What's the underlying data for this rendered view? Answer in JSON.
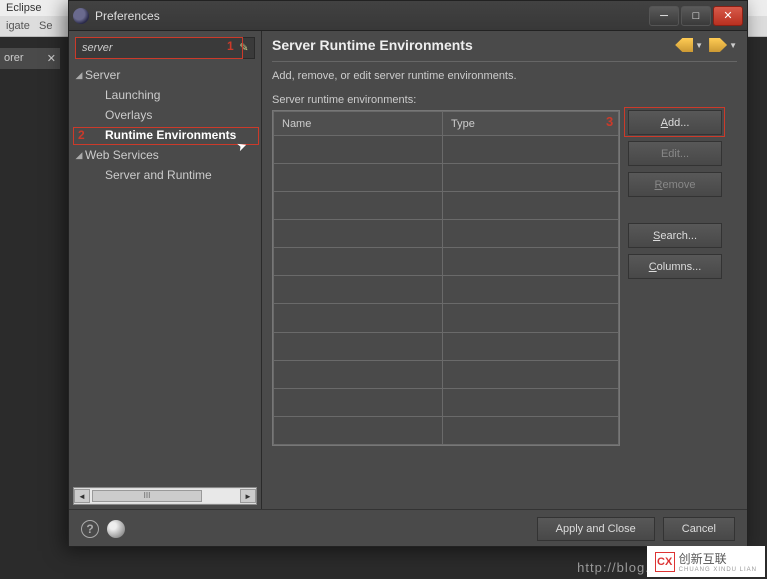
{
  "bg": {
    "title": "Eclipse",
    "menu1": "igate",
    "menu2": "Se",
    "sidebar": "orer"
  },
  "titlebar": {
    "title": "Preferences"
  },
  "search": {
    "value": "server"
  },
  "annotations": {
    "n1": "1",
    "n2": "2",
    "n3": "3"
  },
  "tree": {
    "server": "Server",
    "launching": "Launching",
    "overlays": "Overlays",
    "runtime": "Runtime Environments",
    "webservices": "Web Services",
    "serverruntime": "Server and Runtime"
  },
  "scroll": {
    "thumb_label": "III"
  },
  "right": {
    "title": "Server Runtime Environments",
    "desc": "Add, remove, or edit server runtime environments.",
    "label": "Server runtime environments:",
    "col_name": "Name",
    "col_type": "Type"
  },
  "buttons": {
    "add_u": "A",
    "add_rest": "dd...",
    "edit": "Edit...",
    "remove_u": "R",
    "remove_rest": "emove",
    "search_u": "S",
    "search_rest": "earch...",
    "columns_u": "C",
    "columns_rest": "olumns..."
  },
  "footer": {
    "apply": "Apply and Close",
    "cancel": "Cancel"
  },
  "watermark": "http://blog.csdn.net",
  "brand": {
    "logo": "CX",
    "text": "创新互联",
    "sub": "CHUANG XINDU LIAN"
  }
}
